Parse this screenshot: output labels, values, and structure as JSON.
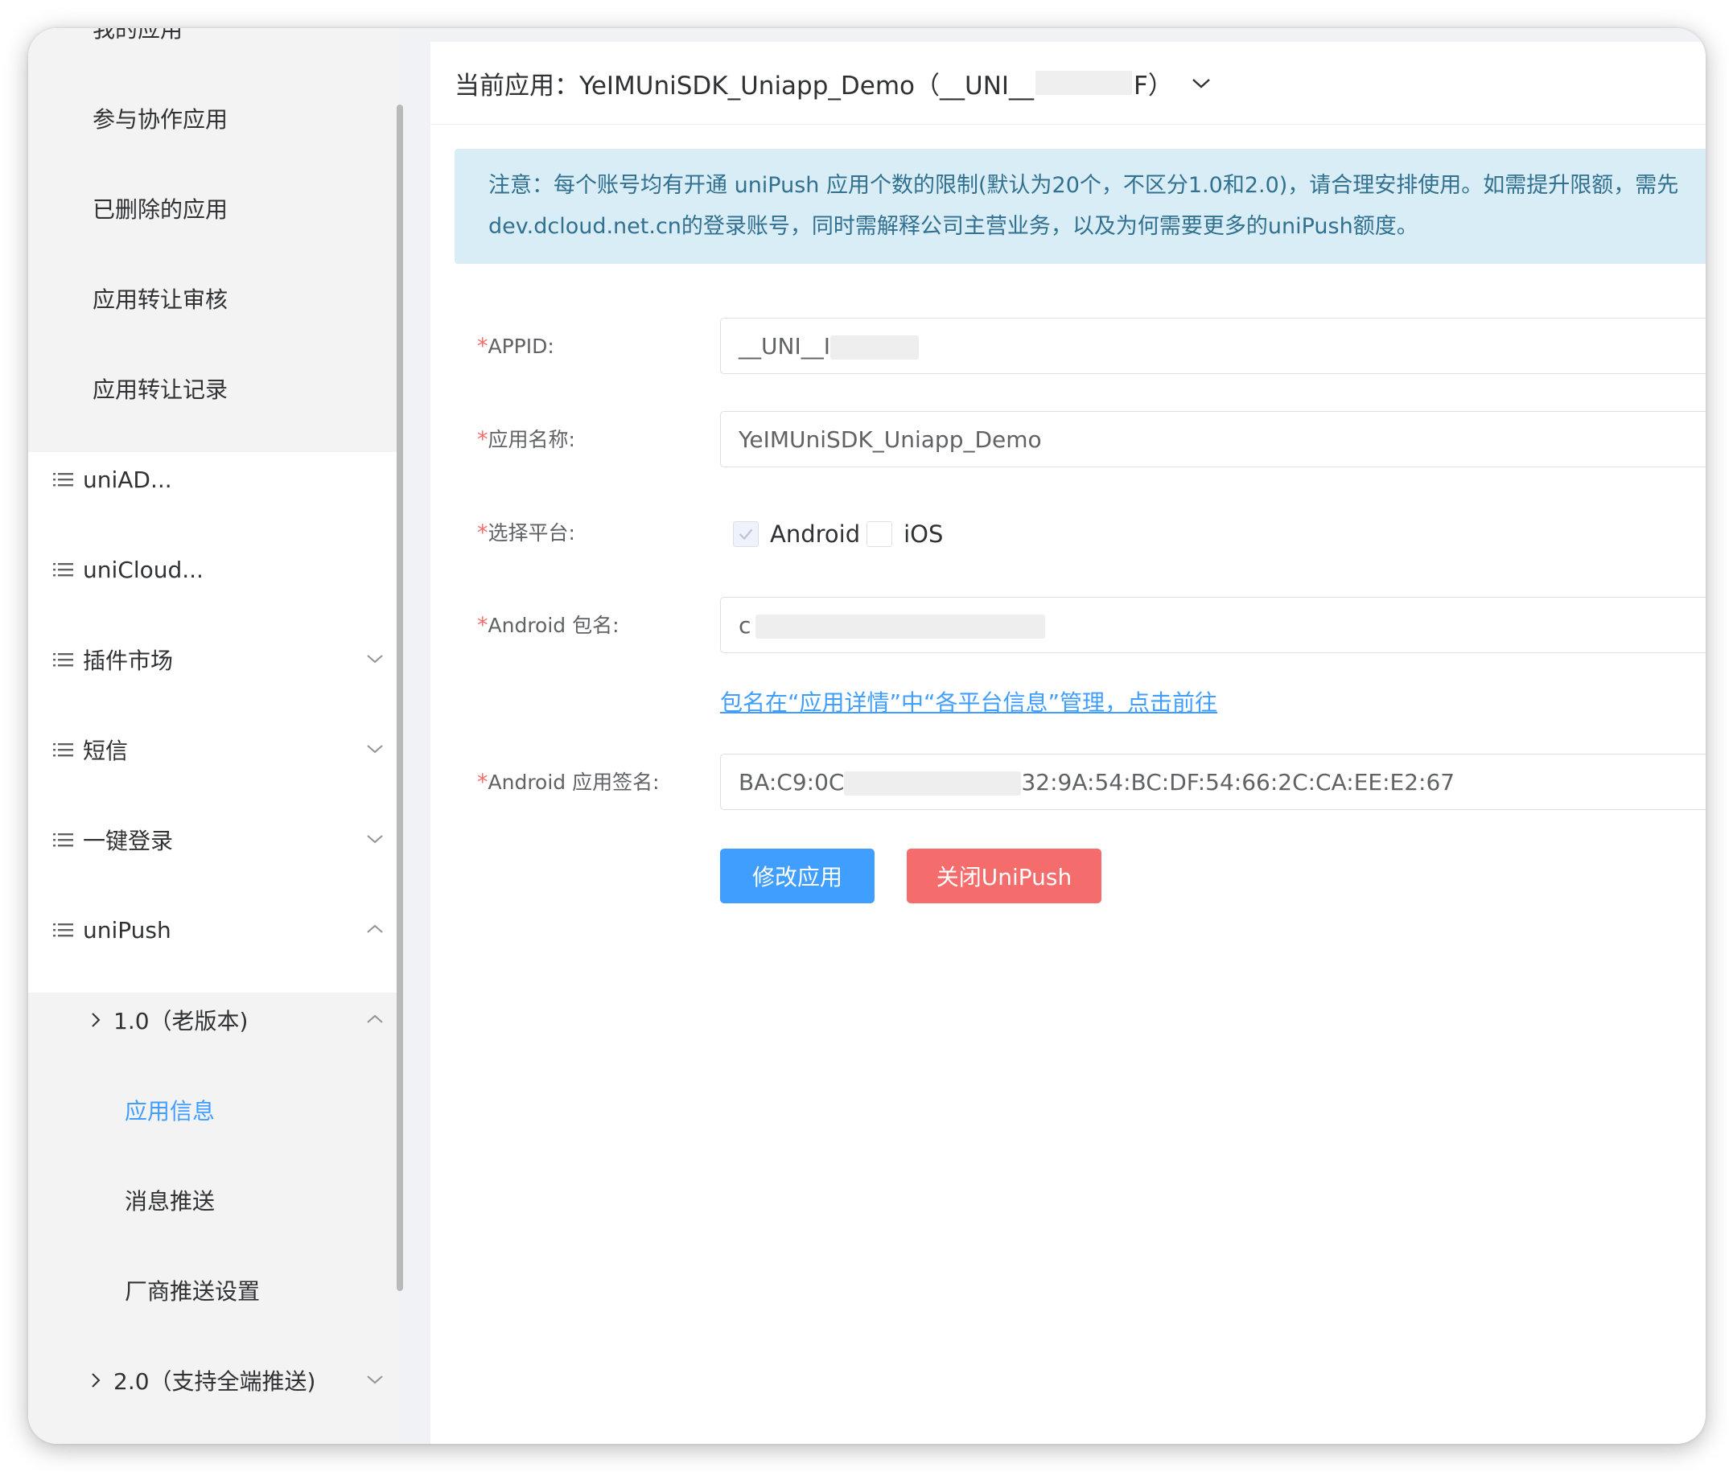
{
  "sidebar": {
    "items": [
      {
        "label": "我的应用"
      },
      {
        "label": "参与协作应用"
      },
      {
        "label": "已删除的应用"
      },
      {
        "label": "应用转让审核"
      },
      {
        "label": "应用转让记录"
      },
      {
        "label": "uniAD...",
        "icon": "list-icon"
      },
      {
        "label": "uniCloud...",
        "icon": "list-icon"
      },
      {
        "label": "插件市场",
        "icon": "list-icon",
        "caret": "chevron-down-icon"
      },
      {
        "label": "短信",
        "icon": "list-icon",
        "caret": "chevron-down-icon"
      },
      {
        "label": "一键登录",
        "icon": "list-icon",
        "caret": "chevron-down-icon"
      },
      {
        "label": "uniPush",
        "icon": "list-icon",
        "caret": "chevron-up-icon"
      }
    ],
    "unipush": {
      "v1": {
        "label": "1.0（老版本)",
        "caret": "chevron-up-icon"
      },
      "sub_items": [
        {
          "label": "应用信息",
          "active": true
        },
        {
          "label": "消息推送"
        },
        {
          "label": "厂商推送设置"
        }
      ],
      "v2": {
        "label": "2.0（支持全端推送)",
        "caret": "chevron-down-icon"
      }
    },
    "active_color": "#409eff"
  },
  "header": {
    "prefix": "当前应用：YeIMUniSDK_Uniapp_Demo（__UNI__",
    "suffix": "F）"
  },
  "notice": {
    "line1": "注意：每个账号均有开通 uniPush 应用个数的限制(默认为20个，不区分1.0和2.0)，请合理安排使用。如需提升限额，需先",
    "line2": "dev.dcloud.net.cn的登录账号，同时需解释公司主营业务，以及为何需要更多的uniPush额度。"
  },
  "form": {
    "required_mark": "*",
    "appid": {
      "label": "APPID:",
      "value": "__UNI__I"
    },
    "app_name": {
      "label": "应用名称:",
      "value": "YeIMUniSDK_Uniapp_Demo"
    },
    "platform": {
      "label": "选择平台:",
      "options": [
        {
          "label": "Android",
          "checked": true,
          "disabled": true
        },
        {
          "label": "iOS",
          "checked": false
        }
      ]
    },
    "android_package": {
      "label": "Android 包名:",
      "value": "c"
    },
    "package_link": "包名在“应用详情”中“各平台信息”管理，点击前往",
    "android_signature": {
      "label": "Android 应用签名:",
      "value_start": "BA:C9:0C",
      "value_end": "32:9A:54:BC:DF:54:66:2C:CA:EE:E2:67"
    }
  },
  "buttons": {
    "modify": "修改应用",
    "close_unipush": "关闭UniPush"
  },
  "colors": {
    "primary": "#409eff",
    "danger": "#f56c6c",
    "notice_bg": "#d9edf7",
    "notice_text": "#31708f"
  }
}
